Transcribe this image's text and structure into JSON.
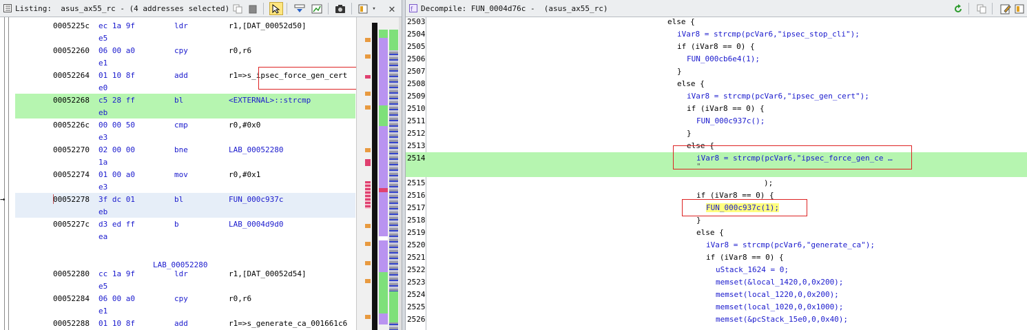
{
  "listing": {
    "title": "Listing:  asus_ax55_rc - (4 addresses selected)",
    "rows": [
      {
        "addr": "0005225c",
        "b1": "ec 1a 9f",
        "b2": "e5",
        "mnem": "ldr",
        "oper": "r1,[DAT_00052d50]"
      },
      {
        "addr": "00052260",
        "b1": "06 00 a0",
        "b2": "e1",
        "mnem": "cpy",
        "oper": "r0,r6"
      },
      {
        "addr": "00052264",
        "b1": "01 10 8f",
        "b2": "e0",
        "mnem": "add",
        "oper": "r1=>s_ipsec_force_gen_cert"
      },
      {
        "addr": "00052268",
        "b1": "c5 28 ff",
        "b2": "eb",
        "mnem": "bl",
        "oper": "<EXTERNAL>::strcmp"
      },
      {
        "addr": "0005226c",
        "b1": "00 00 50",
        "b2": "e3",
        "mnem": "cmp",
        "oper": "r0,#0x0"
      },
      {
        "addr": "00052270",
        "b1": "02 00 00",
        "b2": "1a",
        "mnem": "bne",
        "oper": "LAB_00052280"
      },
      {
        "addr": "00052274",
        "b1": "01 00 a0",
        "b2": "e3",
        "mnem": "mov",
        "oper": "r0,#0x1"
      },
      {
        "addr": "00052278",
        "b1": "3f dc 01",
        "b2": "eb",
        "mnem": "bl",
        "oper": "FUN_000c937c"
      },
      {
        "addr": "0005227c",
        "b1": "d3 ed ff",
        "b2": "ea",
        "mnem": "b",
        "oper": "LAB_0004d9d0"
      },
      {
        "addr": "00052280",
        "b1": "cc 1a 9f",
        "b2": "e5",
        "mnem": "ldr",
        "oper": "r1,[DAT_00052d54]"
      },
      {
        "addr": "00052284",
        "b1": "06 00 a0",
        "b2": "e1",
        "mnem": "cpy",
        "oper": "r0,r6"
      },
      {
        "addr": "00052288",
        "b1": "01 10 8f",
        "b2": "",
        "mnem": "add",
        "oper": "r1=>s_generate_ca_001661c6"
      }
    ],
    "label": "LAB_00052280",
    "colors": {
      "selected_row": "#b6f5b0",
      "cursor_row": "#e6eef8",
      "highlight_box": "#dd2222"
    }
  },
  "decompile": {
    "title": "Decompile: FUN_0004d76c -  (asus_ax55_rc)",
    "lines": [
      {
        "n": "2503",
        "text": "else {"
      },
      {
        "n": "2504",
        "text": "iVar8 = strcmp(pcVar6,\"ipsec_stop_cli\");"
      },
      {
        "n": "2505",
        "text": "if (iVar8 == 0) {"
      },
      {
        "n": "2506",
        "text": "FUN_000cb6e4(1);"
      },
      {
        "n": "2507",
        "text": "}"
      },
      {
        "n": "2508",
        "text": "else {"
      },
      {
        "n": "2509",
        "text": "iVar8 = strcmp(pcVar6,\"ipsec_gen_cert\");"
      },
      {
        "n": "2510",
        "text": "if (iVar8 == 0) {"
      },
      {
        "n": "2511",
        "text": "FUN_000c937c();"
      },
      {
        "n": "2512",
        "text": "}"
      },
      {
        "n": "2513",
        "text": "else {"
      },
      {
        "n": "2514",
        "text": "iVar8 = strcmp(pcVar6,\"ipsec_force_gen_ce …"
      },
      {
        "n": "2515",
        "text": ");"
      },
      {
        "n": "2516",
        "text": "if (iVar8 == 0) {"
      },
      {
        "n": "2517",
        "text": "FUN_000c937c(1);"
      },
      {
        "n": "2518",
        "text": "}"
      },
      {
        "n": "2519",
        "text": "else {"
      },
      {
        "n": "2520",
        "text": "iVar8 = strcmp(pcVar6,\"generate_ca\");"
      },
      {
        "n": "2521",
        "text": "if (iVar8 == 0) {"
      },
      {
        "n": "2522",
        "text": "uStack_1624 = 0;"
      },
      {
        "n": "2523",
        "text": "memset(&local_1420,0,0x200);"
      },
      {
        "n": "2524",
        "text": "memset(local_1220,0,0x200);"
      },
      {
        "n": "2525",
        "text": "memset(local_1020,0,0x1000);"
      },
      {
        "n": "2526",
        "text": "memset(&pcStack_15e0,0,0x40);"
      }
    ]
  }
}
